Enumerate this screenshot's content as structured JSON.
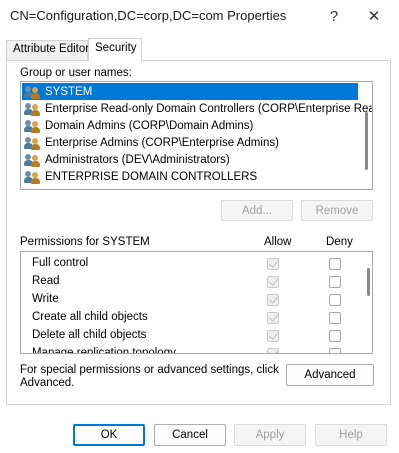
{
  "window": {
    "title": "CN=Configuration,DC=corp,DC=com Properties",
    "help_glyph": "?",
    "close_glyph": "✕"
  },
  "tabs": [
    {
      "label": "Attribute Editor",
      "active": false
    },
    {
      "label": "Security",
      "active": true
    }
  ],
  "security": {
    "group_label": "Group or user names:",
    "principals": [
      {
        "name": "SYSTEM",
        "selected": true,
        "icon": "users-icon"
      },
      {
        "name": "Enterprise Read-only Domain Controllers (CORP\\Enterprise Rea...",
        "selected": false,
        "icon": "users-icon"
      },
      {
        "name": "Domain Admins (CORP\\Domain Admins)",
        "selected": false,
        "icon": "users-icon"
      },
      {
        "name": "Enterprise Admins (CORP\\Enterprise Admins)",
        "selected": false,
        "icon": "users-icon"
      },
      {
        "name": "Administrators (DEV\\Administrators)",
        "selected": false,
        "icon": "users-icon"
      },
      {
        "name": "ENTERPRISE DOMAIN CONTROLLERS",
        "selected": false,
        "icon": "users-icon"
      }
    ],
    "add_label": "Add...",
    "remove_label": "Remove",
    "permissions_label": "Permissions for SYSTEM",
    "allow_header": "Allow",
    "deny_header": "Deny",
    "permissions": [
      {
        "name": "Full control",
        "allow": true,
        "deny": false
      },
      {
        "name": "Read",
        "allow": true,
        "deny": false
      },
      {
        "name": "Write",
        "allow": true,
        "deny": false
      },
      {
        "name": "Create all child objects",
        "allow": true,
        "deny": false
      },
      {
        "name": "Delete all child objects",
        "allow": true,
        "deny": false
      },
      {
        "name": "Manage replication topology",
        "allow": true,
        "deny": false
      }
    ],
    "special_text": "For special permissions or advanced settings, click Advanced.",
    "advanced_label": "Advanced"
  },
  "footer": {
    "ok_label": "OK",
    "cancel_label": "Cancel",
    "apply_label": "Apply",
    "help_label": "Help"
  },
  "colors": {
    "selection": "#0078d7",
    "default_button_border": "#0078d7"
  }
}
